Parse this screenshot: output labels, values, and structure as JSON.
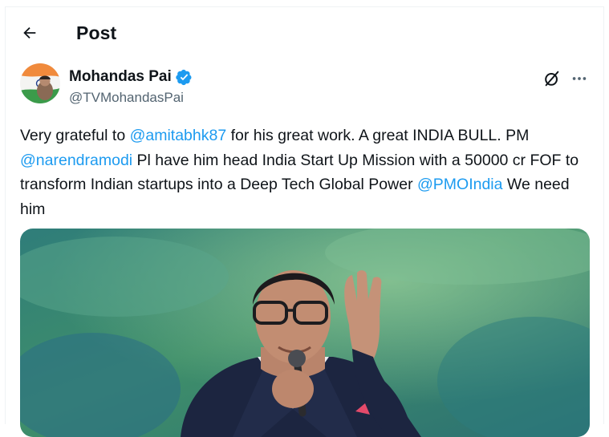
{
  "header": {
    "title": "Post"
  },
  "author": {
    "display_name": "Mohandas Pai",
    "handle": "@TVMohandasPai",
    "verified": true
  },
  "tweet": {
    "segments": [
      {
        "text": "Very grateful to ",
        "type": "text"
      },
      {
        "text": "@amitabhk87",
        "type": "mention"
      },
      {
        "text": " for his great work. A great INDIA BULL. PM ",
        "type": "text"
      },
      {
        "text": "@narendramodi",
        "type": "mention"
      },
      {
        "text": " Pl have him head India Start Up Mission with a 50000 cr FOF to transform Indian startups into a Deep Tech Global Power ",
        "type": "text"
      },
      {
        "text": "@PMOIndia",
        "type": "mention"
      },
      {
        "text": " We need him",
        "type": "text"
      }
    ]
  },
  "icons": {
    "back": "arrow-left-icon",
    "verified": "verified-badge-icon",
    "grok": "grok-icon",
    "more": "more-horizontal-icon"
  },
  "colors": {
    "accent": "#1d9bf0",
    "text": "#0f1419",
    "secondary": "#536471"
  }
}
